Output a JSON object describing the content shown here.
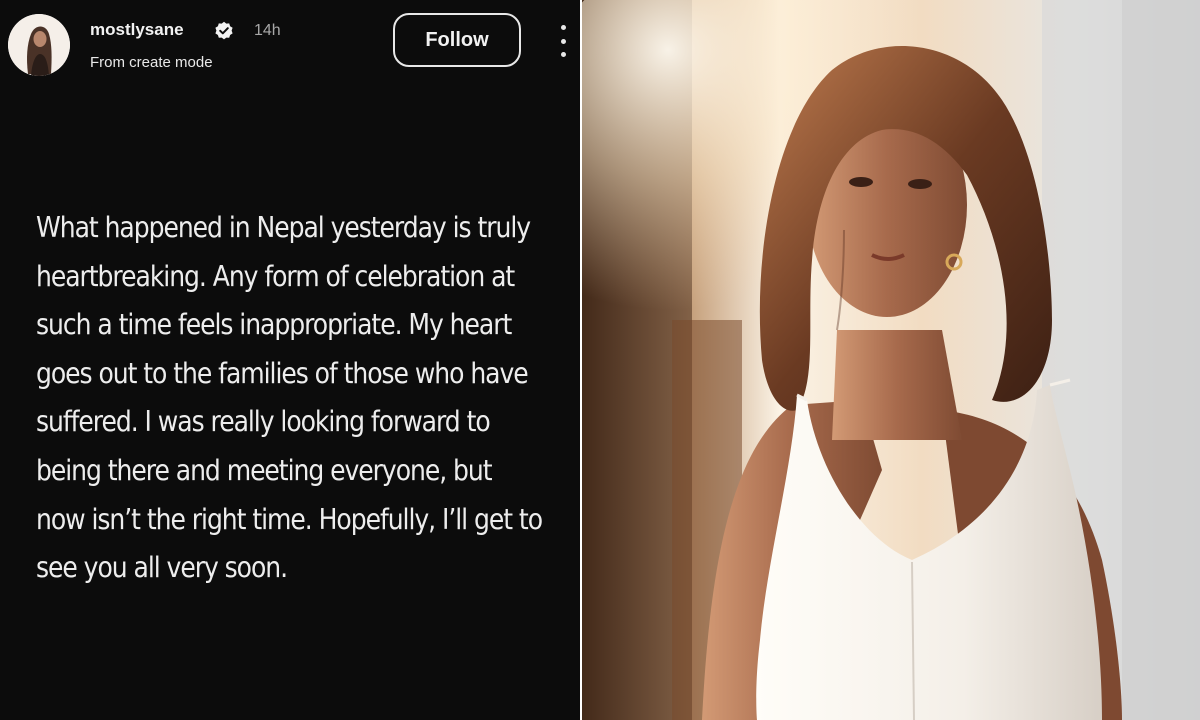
{
  "post": {
    "username": "mostlysane",
    "time": "14h",
    "subtitle": "From create mode",
    "follow_label": "Follow",
    "story_text": "What happened in Nepal yesterday is truly heartbreaking. Any form of celebration at such a time feels inappropriate. My heart goes out to the families of those who have suffered. I was really looking forward to being there and meeting everyone, but now isn’t the right time. Hopefully, I’ll get to see you all very soon."
  },
  "icons": {
    "verified": "verified-badge-icon",
    "more": "more-options-icon"
  },
  "colors": {
    "story_background": "#0c0c0c",
    "text": "#ededed",
    "secondary_text": "#a8a8a8",
    "dress": "#f4efe8"
  }
}
